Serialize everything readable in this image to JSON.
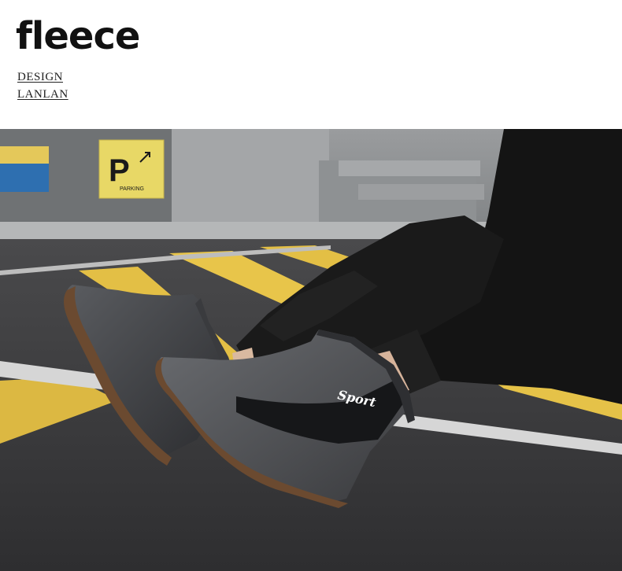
{
  "header": {
    "title": "fleece",
    "line1": "DESIGN",
    "line2": "LANLAN"
  },
  "photo": {
    "parking_sign": "P",
    "parking_sign_sub": "PARKING",
    "boot_logo": "Sport",
    "colors": {
      "asphalt": "#3b3b3d",
      "stripe_yellow": "#e8c54a",
      "boot_gray": "#4a4c50",
      "sole_brown": "#6b4a30",
      "pants_black": "#141414"
    }
  }
}
